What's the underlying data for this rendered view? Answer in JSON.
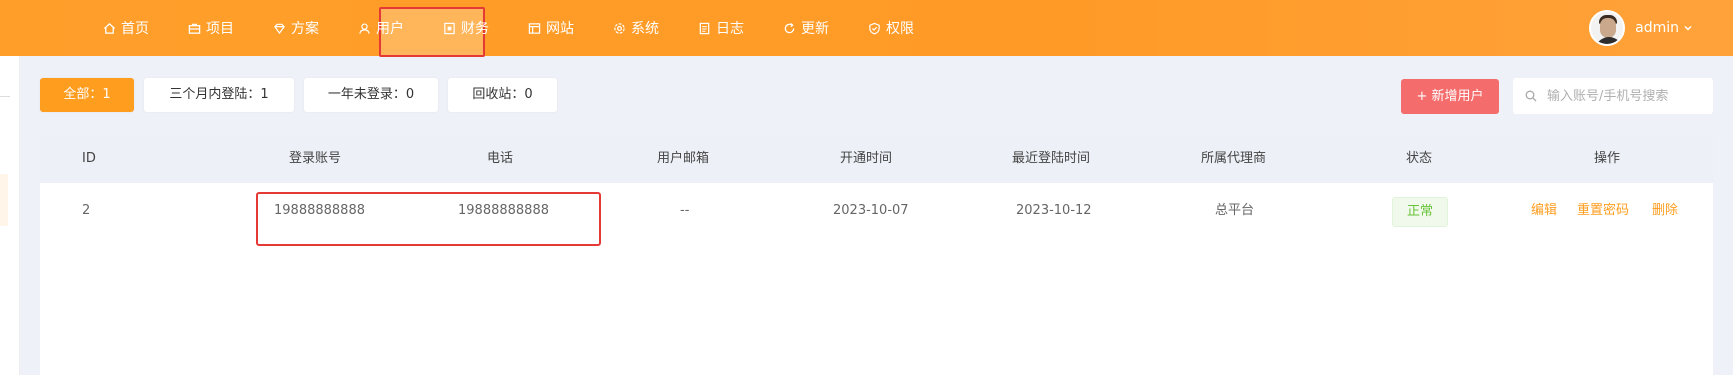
{
  "nav": {
    "items": [
      {
        "label": "首页",
        "icon": "home-icon"
      },
      {
        "label": "项目",
        "icon": "briefcase-icon"
      },
      {
        "label": "方案",
        "icon": "diamond-icon"
      },
      {
        "label": "用户",
        "icon": "users-icon"
      },
      {
        "label": "财务",
        "icon": "finance-icon"
      },
      {
        "label": "网站",
        "icon": "layout-icon"
      },
      {
        "label": "系统",
        "icon": "gear-icon"
      },
      {
        "label": "日志",
        "icon": "document-icon"
      },
      {
        "label": "更新",
        "icon": "refresh-icon"
      },
      {
        "label": "权限",
        "icon": "shield-icon"
      }
    ],
    "active": "用户",
    "user_name": "admin"
  },
  "filters": [
    {
      "label": "全部：1",
      "active": true
    },
    {
      "label": "三个月内登陆：1",
      "active": false
    },
    {
      "label": "一年未登录：0",
      "active": false
    },
    {
      "label": "回收站：0",
      "active": false
    }
  ],
  "toolbar": {
    "add_label": "+ 新增用户",
    "search_placeholder": "输入账号/手机号搜索"
  },
  "table": {
    "columns": [
      "ID",
      "登录账号",
      "电话",
      "用户邮箱",
      "开通时间",
      "最近登陆时间",
      "所属代理商",
      "状态",
      "操作"
    ],
    "rows": [
      {
        "id": "2",
        "account": "19888888888",
        "phone": "19888888888",
        "email": "--",
        "opened": "2023-10-07",
        "last_login": "2023-10-12",
        "agent": "总平台",
        "status": "正常",
        "actions": [
          "编辑",
          "重置密码",
          "删除"
        ]
      }
    ]
  },
  "colors": {
    "brand": "#ff9d1f",
    "danger": "#f56c6c",
    "success": "#67c23a",
    "highlight": "#e53935"
  }
}
